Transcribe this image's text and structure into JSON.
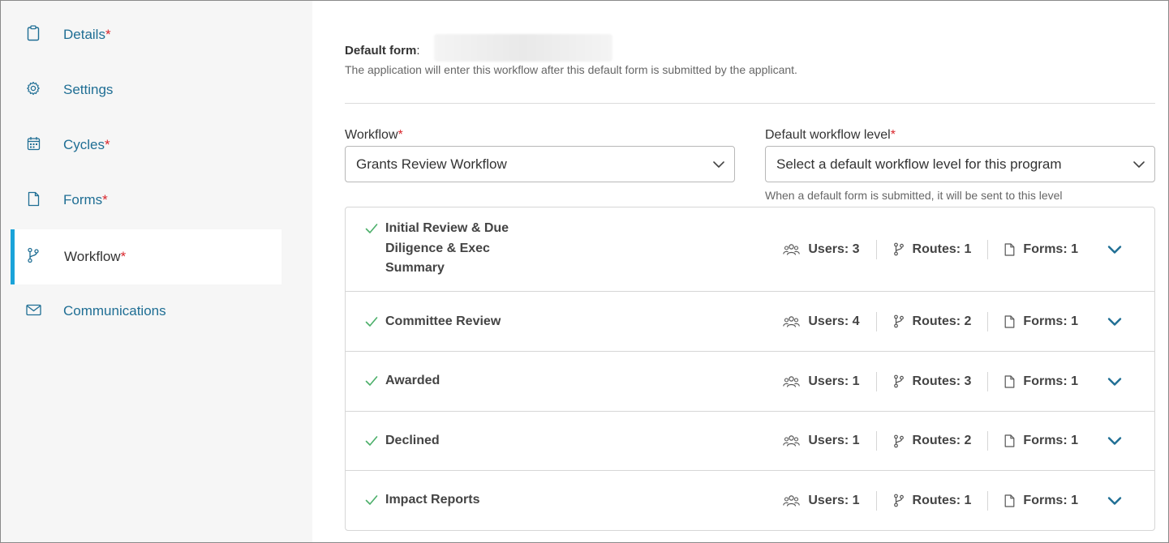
{
  "sidebar": {
    "items": [
      {
        "label": "Details",
        "required": "*",
        "icon": "clipboard-icon",
        "active": false
      },
      {
        "label": "Settings",
        "required": "",
        "icon": "gear-icon",
        "active": false
      },
      {
        "label": "Cycles",
        "required": "*",
        "icon": "calendar-icon",
        "active": false
      },
      {
        "label": "Forms",
        "required": "*",
        "icon": "document-icon",
        "active": false
      },
      {
        "label": "Workflow",
        "required": "*",
        "icon": "branch-icon",
        "active": true
      },
      {
        "label": "Communications",
        "required": "",
        "icon": "envelope-icon",
        "active": false
      }
    ]
  },
  "main": {
    "default_form_label": "Default form",
    "default_form_desc": "The application will enter this workflow after this default form is submitted by the applicant.",
    "workflow": {
      "label": "Workflow",
      "required": "*",
      "value": "Grants Review Workflow"
    },
    "default_level": {
      "label": "Default workflow level",
      "required": "*",
      "placeholder": "Select a default workflow level for this program",
      "hint": "When a default form is submitted, it will be sent to this level"
    },
    "levels": [
      {
        "name": "Initial Review & Due Diligence & Exec Summary",
        "users": "Users: 3",
        "routes": "Routes: 1",
        "forms": "Forms: 1"
      },
      {
        "name": "Committee Review",
        "users": "Users: 4",
        "routes": "Routes: 2",
        "forms": "Forms: 1"
      },
      {
        "name": "Awarded",
        "users": "Users: 1",
        "routes": "Routes: 3",
        "forms": "Forms: 1"
      },
      {
        "name": "Declined",
        "users": "Users: 1",
        "routes": "Routes: 2",
        "forms": "Forms: 1"
      },
      {
        "name": "Impact Reports",
        "users": "Users: 1",
        "routes": "Routes: 1",
        "forms": "Forms: 1"
      }
    ]
  },
  "colors": {
    "link": "#1f6e94",
    "required": "#d9262c",
    "active_bar": "#1aa3d9",
    "check": "#4caf6a",
    "chevron": "#1f6e94"
  }
}
